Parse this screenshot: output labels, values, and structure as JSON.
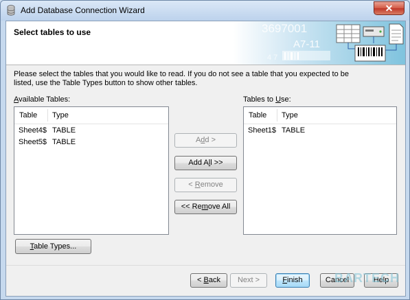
{
  "window": {
    "title": "Add Database Connection Wizard",
    "close_glyph": "✕"
  },
  "header": {
    "title": "Select tables to use",
    "art_texts": [
      "3697001",
      "A7-11",
      "4 7"
    ]
  },
  "instructions": "Please select the tables that you would like to read.  If you do not see a table that you expected to be listed, use the Table Types button to show other tables.",
  "available": {
    "label_hotkey": "A",
    "label_rest": "vailable Tables:",
    "columns": [
      "Table",
      "Type"
    ],
    "rows": [
      {
        "table": "Sheet4$",
        "type": "TABLE"
      },
      {
        "table": "Sheet5$",
        "type": "TABLE"
      }
    ]
  },
  "to_use": {
    "label_pre": "Tables to ",
    "label_hotkey": "U",
    "label_post": "se:",
    "columns": [
      "Table",
      "Type"
    ],
    "rows": [
      {
        "table": "Sheet1$",
        "type": "TABLE"
      }
    ]
  },
  "mid_buttons": {
    "add_pre": "A",
    "add_hotkey": "d",
    "add_post": "d >",
    "add_all_pre": "Add A",
    "add_all_hotkey": "l",
    "add_all_post": "l >>",
    "remove_pre": "< ",
    "remove_hotkey": "R",
    "remove_post": "emove",
    "remove_all_pre": "<< Re",
    "remove_all_hotkey": "m",
    "remove_all_post": "ove All"
  },
  "table_types": {
    "hotkey": "T",
    "rest": "able Types..."
  },
  "footer": {
    "back_pre": "< ",
    "back_hotkey": "B",
    "back_post": "ack",
    "next_pre": "Next >",
    "finish_hotkey": "F",
    "finish_post": "inish",
    "cancel": "Cancel",
    "help": "Help"
  },
  "watermark": "BARTECH",
  "colors": {
    "title_bar": "#bcd2ec",
    "close_button": "#c0382a",
    "default_button": "#3c7fb1",
    "dialog_bg": "#f0f0f0"
  }
}
